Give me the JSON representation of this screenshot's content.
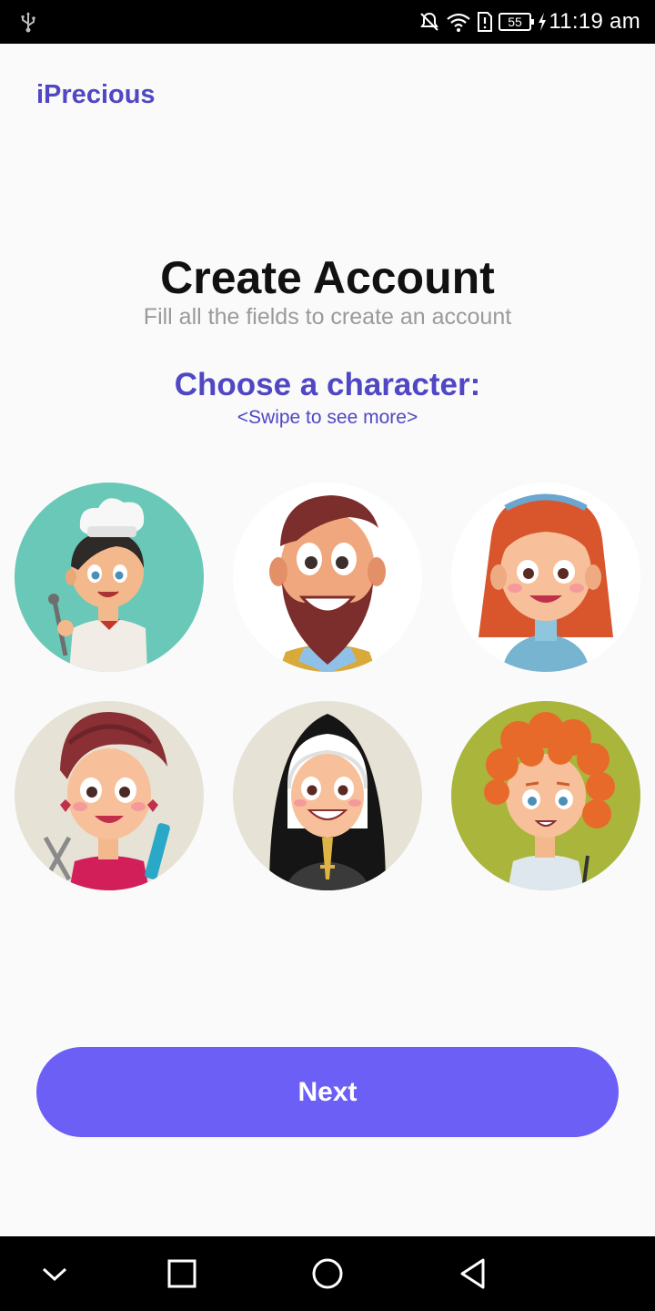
{
  "status_bar": {
    "time": "11:19 am",
    "battery_level": "55",
    "icons": [
      "usb-icon",
      "mute-icon",
      "wifi-icon",
      "sim-alert-icon",
      "battery-icon",
      "charging-icon"
    ]
  },
  "header": {
    "app_title": "iPrecious"
  },
  "main": {
    "title": "Create Account",
    "subtitle": "Fill all the fields to create an account",
    "choose_label": "Choose a character:",
    "swipe_hint": "<Swipe to see more>",
    "characters": [
      "chef",
      "bearded-man",
      "red-haired-woman",
      "hairdresser",
      "nun",
      "curly-haired-kid"
    ]
  },
  "footer": {
    "next_label": "Next"
  },
  "nav_bar": {
    "icons": [
      "collapse-icon",
      "recents-icon",
      "home-icon",
      "back-icon"
    ]
  },
  "colors": {
    "brand": "#5047c4",
    "button": "#6c5ff6",
    "title": "#111111",
    "subtitle": "#9a9a9a"
  }
}
